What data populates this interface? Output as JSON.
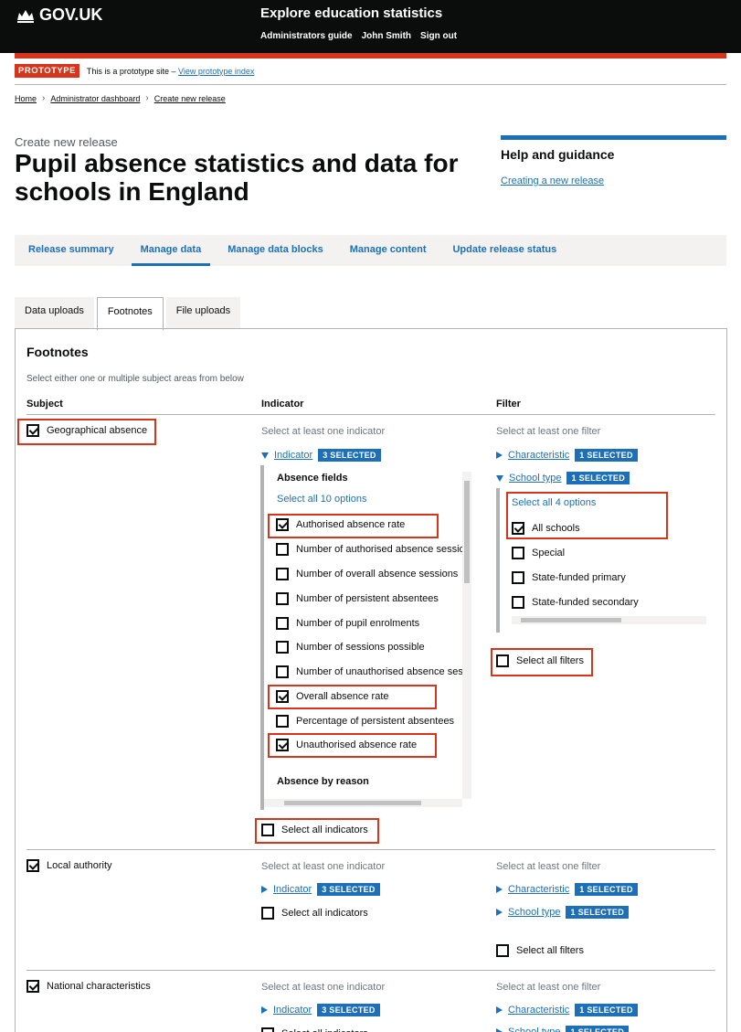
{
  "header": {
    "logo": "GOV.UK",
    "service": "Explore education statistics",
    "nav": [
      "Administrators guide",
      "John Smith",
      "Sign out"
    ]
  },
  "phase": {
    "tag": "PROTOTYPE",
    "text": "This is a prototype site –",
    "link": "View prototype index"
  },
  "breadcrumbs": [
    "Home",
    "Administrator dashboard",
    "Create new release"
  ],
  "page": {
    "caption": "Create new release",
    "title": "Pupil absence statistics and data for schools in England"
  },
  "help": {
    "heading": "Help and guidance",
    "link": "Creating a new release"
  },
  "nav": {
    "items": [
      "Release summary",
      "Manage data",
      "Manage data blocks",
      "Manage content",
      "Update release status"
    ],
    "active": "Manage data"
  },
  "subtabs": {
    "items": [
      "Data uploads",
      "Footnotes",
      "File uploads"
    ],
    "active": "Footnotes"
  },
  "footnotes": {
    "title": "Footnotes",
    "hint": "Select either one or multiple subject areas from below",
    "columns": [
      "Subject",
      "Indicator",
      "Filter"
    ],
    "indicator_hint": "Select at least one indicator",
    "filter_hint": "Select at least one filter",
    "indicator_label": "Indicator",
    "selected_3": "3 SELECTED",
    "selected_1": "1 SELECTED",
    "characteristic_label": "Characteristic",
    "school_type_label": "School type",
    "select_all_indicators": "Select all indicators",
    "select_all_filters": "Select all filters",
    "subjects": [
      "Geographical absence",
      "Local authority",
      "National characteristics"
    ],
    "absence_fields": {
      "heading": "Absence fields",
      "select_all": "Select all 10 options",
      "options": [
        {
          "label": "Authorised absence rate",
          "checked": true
        },
        {
          "label": "Number of authorised absence sessions",
          "checked": false
        },
        {
          "label": "Number of overall absence sessions",
          "checked": false
        },
        {
          "label": "Number of persistent absentees",
          "checked": false
        },
        {
          "label": "Number of pupil enrolments",
          "checked": false
        },
        {
          "label": "Number of sessions possible",
          "checked": false
        },
        {
          "label": "Number of unauthorised absence sessions",
          "checked": false
        },
        {
          "label": "Overall absence rate",
          "checked": true
        },
        {
          "label": "Percentage of persistent absentees",
          "checked": false
        },
        {
          "label": "Unauthorised absence rate",
          "checked": true
        }
      ],
      "next_heading": "Absence by reason"
    },
    "school_type": {
      "select_all": "Select all 4 options",
      "options": [
        {
          "label": "All schools",
          "checked": true
        },
        {
          "label": "Special",
          "checked": false
        },
        {
          "label": "State-funded primary",
          "checked": false
        },
        {
          "label": "State-funded secondary",
          "checked": false
        }
      ]
    }
  },
  "colors": {
    "header_bg": "#0b0c0c",
    "accent": "#1d70b8",
    "red": "#d4351c"
  }
}
